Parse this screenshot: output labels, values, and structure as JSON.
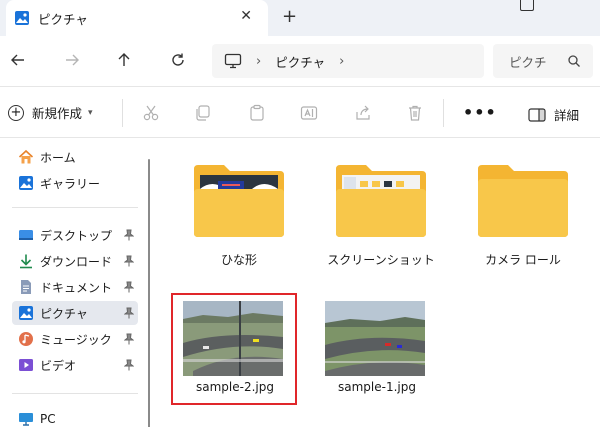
{
  "tab": {
    "title": "ピクチャ",
    "close": "✕",
    "new": "+"
  },
  "address": {
    "location": "ピクチャ",
    "sep": "›",
    "sep2": "›"
  },
  "search": {
    "placeholder": "ピクチ"
  },
  "toolbar": {
    "new_label": "新規作成",
    "more": "•••",
    "details_label": "詳細"
  },
  "sidebar": {
    "quick": [
      {
        "label": "ホーム"
      },
      {
        "label": "ギャラリー"
      }
    ],
    "pinned": [
      {
        "label": "デスクトップ"
      },
      {
        "label": "ダウンロード"
      },
      {
        "label": "ドキュメント"
      },
      {
        "label": "ピクチャ"
      },
      {
        "label": "ミュージック"
      },
      {
        "label": "ビデオ"
      }
    ],
    "pc": {
      "label": "PC"
    }
  },
  "items": [
    {
      "name": "ひな形",
      "type": "folder"
    },
    {
      "name": "スクリーンショット",
      "type": "folder"
    },
    {
      "name": "カメラ ロール",
      "type": "folder"
    },
    {
      "name": "sample-2.jpg",
      "type": "image"
    },
    {
      "name": "sample-1.jpg",
      "type": "image"
    }
  ],
  "colors": {
    "folder": "#f8c74a",
    "folder_back": "#f4b532",
    "selection_outline": "#e0262a",
    "accent": "#0067c0"
  }
}
